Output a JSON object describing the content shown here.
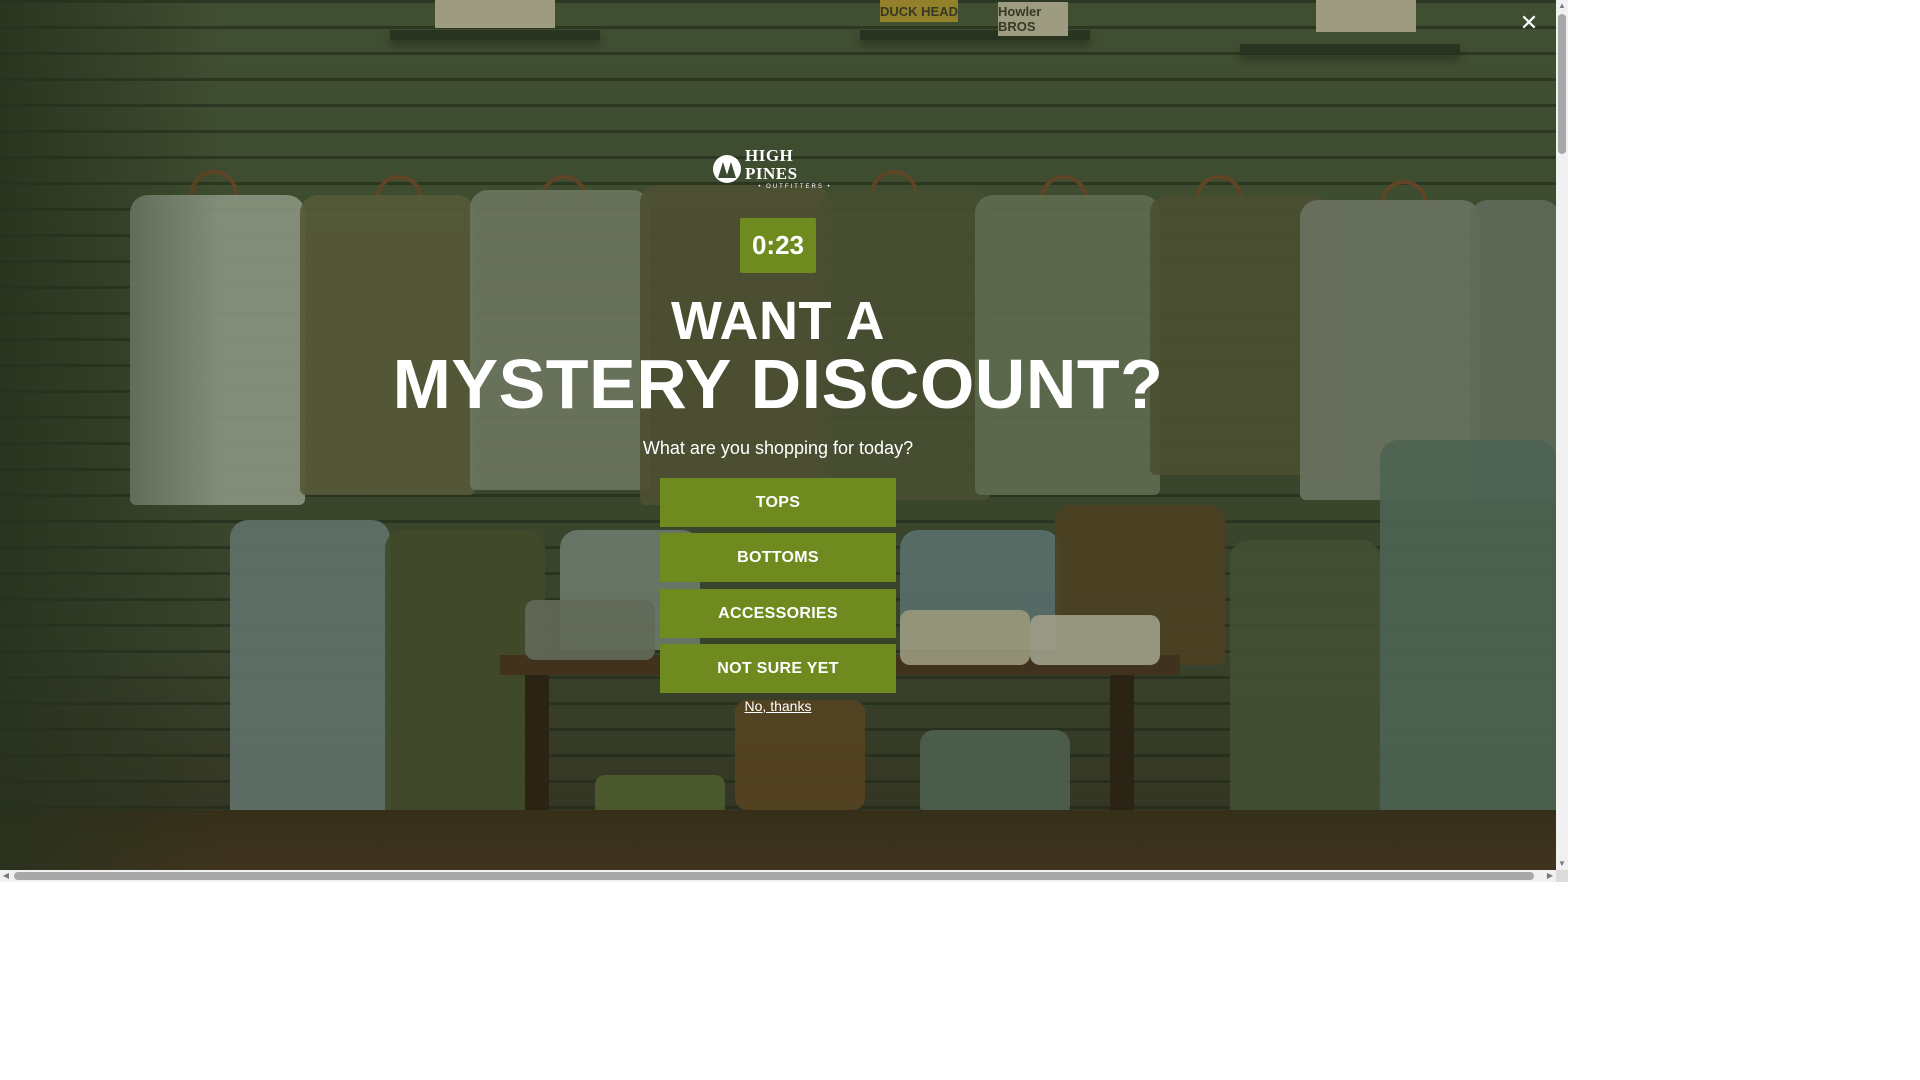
{
  "popup": {
    "logo": {
      "name": "HIGH PINES",
      "sub": "• OUTFITTERS •"
    },
    "timer": "0:23",
    "headline_line1": "WANT A",
    "headline_line2": "MYSTERY DISCOUNT?",
    "question": "What are you shopping for today?",
    "choices": [
      "TOPS",
      "BOTTOMS",
      "ACCESSORIES",
      "NOT SURE YET"
    ],
    "dismiss_label": "No, thanks",
    "close_icon": "close-icon"
  },
  "background": {
    "signs": [
      "DUCK HEAD",
      "Howler BROS"
    ]
  },
  "colors": {
    "accent": "#6f8b1f",
    "text": "#ffffff"
  }
}
